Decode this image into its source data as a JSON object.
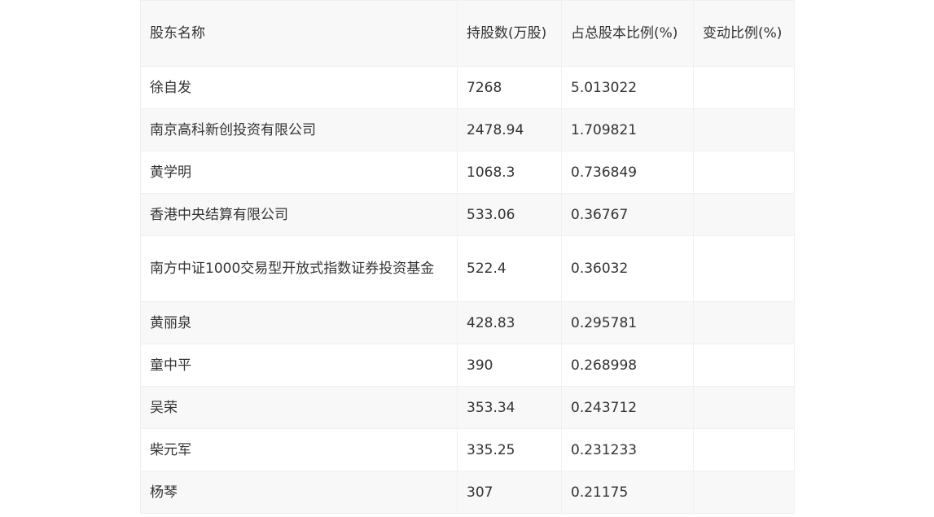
{
  "table": {
    "headers": [
      "股东名称",
      "持股数(万股)",
      "占总股本比例(%)",
      "变动比例(%)"
    ],
    "rows": [
      [
        "徐自发",
        "7268",
        "5.013022",
        ""
      ],
      [
        "南京高科新创投资有限公司",
        "2478.94",
        "1.709821",
        ""
      ],
      [
        "黄学明",
        "1068.3",
        "0.736849",
        ""
      ],
      [
        "香港中央结算有限公司",
        "533.06",
        "0.36767",
        ""
      ],
      [
        "南方中证1000交易型开放式指数证券投资基金",
        "522.4",
        "0.36032",
        ""
      ],
      [
        "黄丽泉",
        "428.83",
        "0.295781",
        ""
      ],
      [
        "童中平",
        "390",
        "0.268998",
        ""
      ],
      [
        "吴荣",
        "353.34",
        "0.243712",
        ""
      ],
      [
        "柴元军",
        "335.25",
        "0.231233",
        ""
      ],
      [
        "杨琴",
        "307",
        "0.21175",
        ""
      ]
    ]
  }
}
